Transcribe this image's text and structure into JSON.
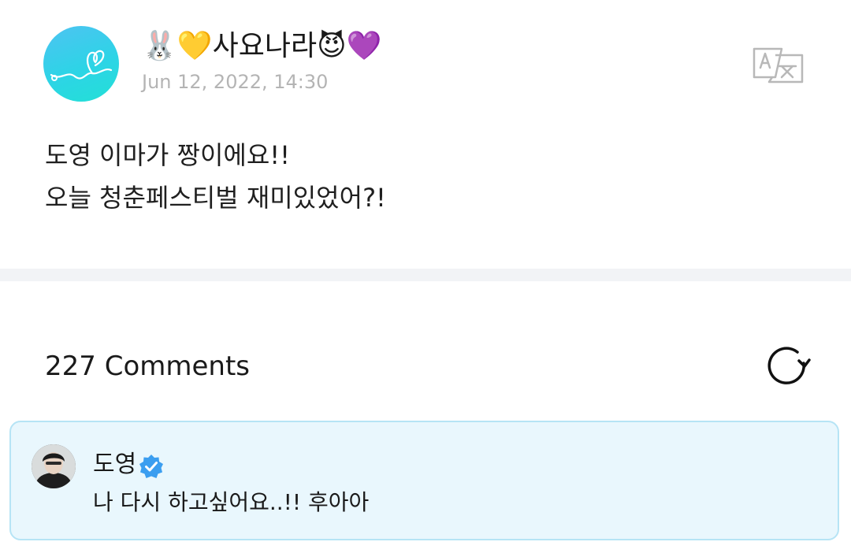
{
  "post": {
    "author_name": "🐰💛사요나라😈💜",
    "date": "Jun 12, 2022, 14:30",
    "lines": [
      "도영 이마가 짱이에요!!",
      "오늘 청춘페스티벌 재미있었어?!"
    ]
  },
  "comments": {
    "count_label": "227 Comments"
  },
  "comment": {
    "author": "도영",
    "text": "나 다시 하고싶어요..!! 후아아"
  },
  "colors": {
    "avatar_gradient_start": "#4ec3f2",
    "avatar_gradient_end": "#22e0d6",
    "comment_card_bg": "#e9f7fd",
    "comment_card_border": "#b6e4f5",
    "verified_badge": "#3b9ef0",
    "date_text": "#b4b4b4",
    "divider": "#f2f3f6"
  },
  "icons": {
    "translate": "translate-icon",
    "refresh": "refresh-icon",
    "verified": "verified-badge-icon"
  }
}
